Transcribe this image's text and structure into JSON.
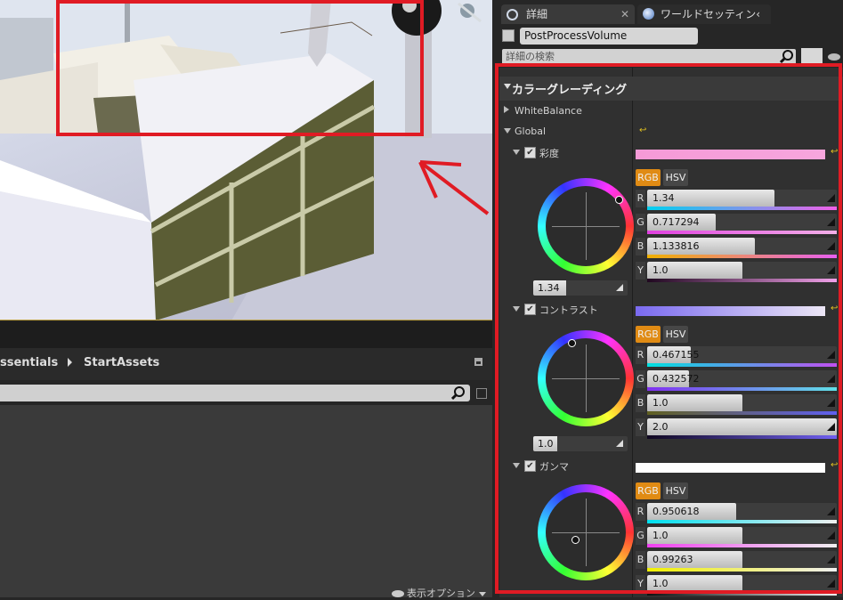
{
  "content_browser": {
    "breadcrumb": [
      "ssentials",
      "StartAssets"
    ],
    "view_options_label": "表示オプション"
  },
  "details": {
    "tabs": [
      {
        "label": "詳細",
        "icon": "magnifier-icon"
      },
      {
        "label": "ワールドセッティン‹",
        "icon": "globe-icon"
      }
    ],
    "object_name": "PostProcessVolume",
    "search_placeholder": "詳細の検索",
    "section_title": "カラーグレーディング",
    "white_balance_label": "WhiteBalance",
    "global_label": "Global",
    "groups": [
      {
        "label": "彩度",
        "wheel_value": "1.34",
        "wheel_value_fraction": 0.35,
        "mode_buttons": [
          "RGB",
          "HSV"
        ],
        "active_mode": "RGB",
        "swatch_colors": [
          "#f59ad7",
          "#f7a6dd"
        ],
        "channels": [
          {
            "label": "R",
            "value": "1.34",
            "fraction": 0.67,
            "gradient": [
              "#00d0f0",
              "#f060e8"
            ]
          },
          {
            "label": "G",
            "value": "0.717294",
            "fraction": 0.36,
            "gradient": [
              "#e040e0",
              "#f3b0e8"
            ]
          },
          {
            "label": "B",
            "value": "1.133816",
            "fraction": 0.57,
            "gradient": [
              "#f0b000",
              "#e860f0"
            ]
          },
          {
            "label": "Y",
            "value": "1.0",
            "fraction": 0.5,
            "gradient": [
              "#200820",
              "#f0a0e8"
            ]
          }
        ]
      },
      {
        "label": "コントラスト",
        "wheel_value": "1.0",
        "wheel_value_fraction": 0.25,
        "mode_buttons": [
          "RGB",
          "HSV"
        ],
        "active_mode": "RGB",
        "swatch_colors": [
          "#7a6af0",
          "#ece6f5"
        ],
        "channels": [
          {
            "label": "R",
            "value": "0.467155",
            "fraction": 0.23,
            "gradient": [
              "#00e0e0",
              "#c050f0"
            ]
          },
          {
            "label": "G",
            "value": "0.432572",
            "fraction": 0.22,
            "gradient": [
              "#8030f0",
              "#60e0e8"
            ]
          },
          {
            "label": "B",
            "value": "1.0",
            "fraction": 0.5,
            "gradient": [
              "#606020",
              "#6060f0"
            ]
          },
          {
            "label": "Y",
            "value": "2.0",
            "fraction": 1.0,
            "gradient": [
              "#100820",
              "#7060f0"
            ]
          }
        ]
      },
      {
        "label": "ガンマ",
        "mode_buttons": [
          "RGB",
          "HSV"
        ],
        "active_mode": "RGB",
        "swatch_colors": [
          "#ffffff",
          "#ffffff"
        ],
        "channels": [
          {
            "label": "R",
            "value": "0.950618",
            "fraction": 0.47,
            "gradient": [
              "#00e0f0",
              "#f0f0f0"
            ]
          },
          {
            "label": "G",
            "value": "1.0",
            "fraction": 0.5,
            "gradient": [
              "#f040f0",
              "#f0f0f0"
            ]
          },
          {
            "label": "B",
            "value": "0.99263",
            "fraction": 0.5,
            "gradient": [
              "#f0f000",
              "#f0f0f0"
            ]
          },
          {
            "label": "Y",
            "value": "1.0",
            "fraction": 0.5,
            "gradient": [
              "#101010",
              "#f0f0f0"
            ]
          }
        ]
      }
    ]
  },
  "colors": {
    "annotation": "#e01b24",
    "accent": "#e08b14"
  }
}
